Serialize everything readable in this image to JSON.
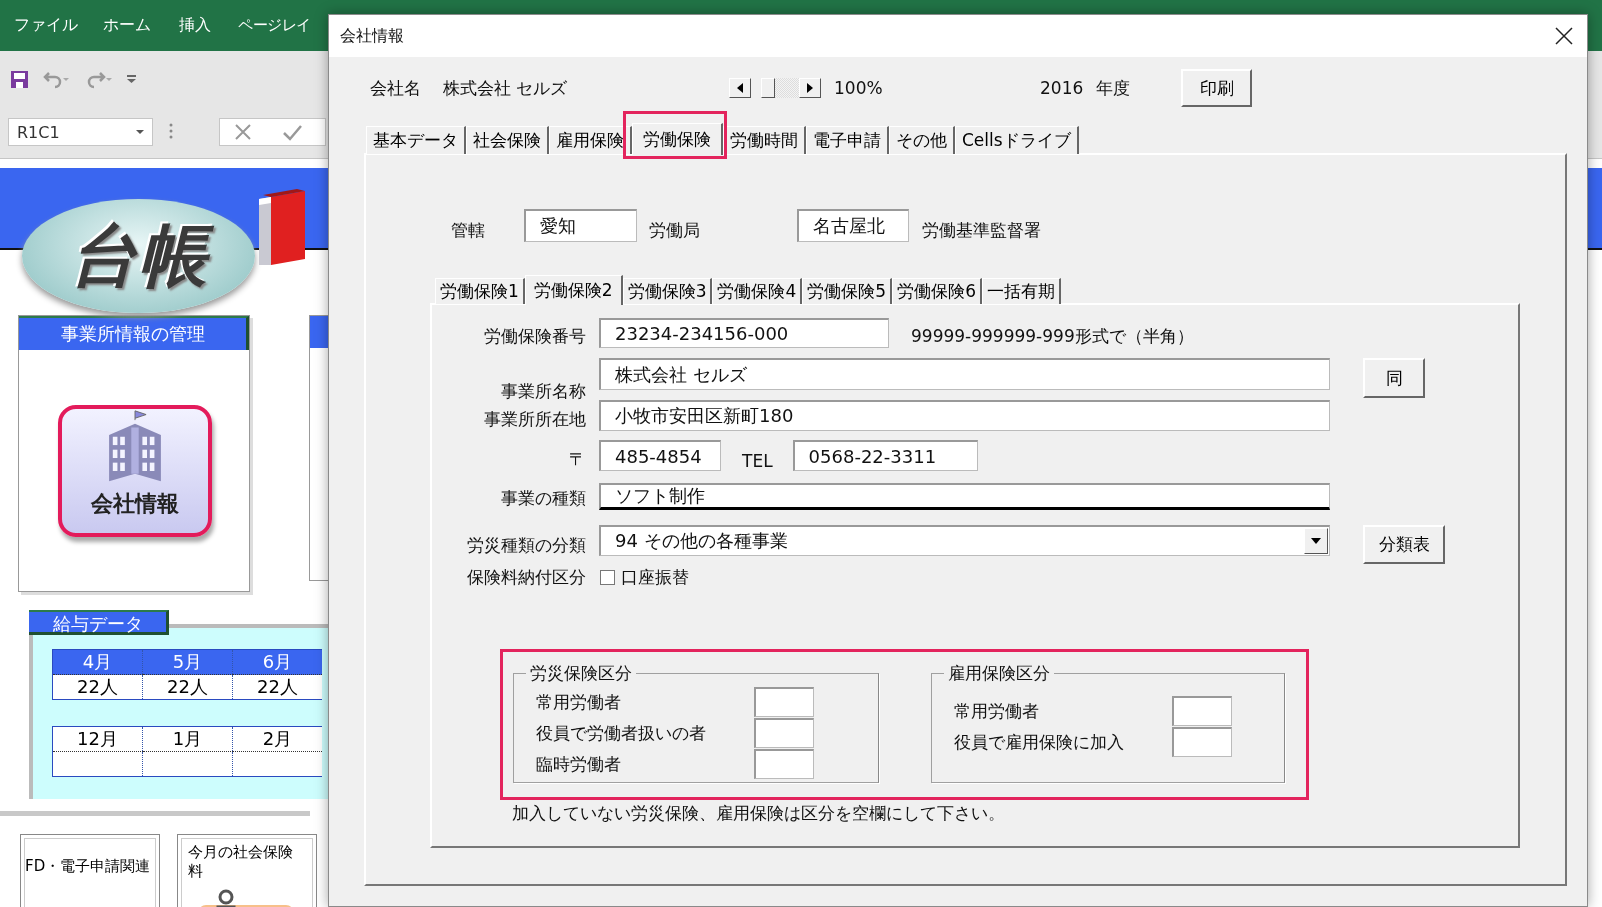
{
  "app": {
    "menu": [
      "ファイル",
      "ホーム",
      "挿入",
      "ページレイ"
    ],
    "name_box": "R1C1"
  },
  "sheet": {
    "logo": "台帳",
    "company_panel": {
      "title": "事業所情報の管理",
      "button": "会社情報"
    },
    "salary": {
      "title": "給与データ",
      "rows": [
        {
          "highlighted": true,
          "cells": [
            {
              "month": "4月",
              "count": "22人"
            },
            {
              "month": "5月",
              "count": "22人"
            },
            {
              "month": "6月",
              "count": "22人"
            }
          ]
        },
        {
          "highlighted": false,
          "cells": [
            {
              "month": "12月"
            },
            {
              "month": "1月"
            },
            {
              "month": "2月"
            }
          ]
        }
      ]
    },
    "links": [
      "FD・電子申請関連",
      "今月の社会保険料"
    ]
  },
  "dialog": {
    "title": "会社情報",
    "company_label": "会社名",
    "company_name": "株式会社 セルズ",
    "zoom": "100%",
    "year": "2016",
    "year_label": "年度",
    "print_button": "印刷",
    "tabs": [
      {
        "label": "基本データ",
        "selected": false
      },
      {
        "label": "社会保険",
        "selected": false
      },
      {
        "label": "雇用保険",
        "selected": false
      },
      {
        "label": "労働保険",
        "selected": true
      },
      {
        "label": "労働時間",
        "selected": false
      },
      {
        "label": "電子申請",
        "selected": false
      },
      {
        "label": "その他",
        "selected": false
      },
      {
        "label": "Cellsドライブ",
        "selected": false
      }
    ],
    "jurisdiction": {
      "label": "管轄",
      "bureau": "愛知",
      "bureau_suffix": "労働局",
      "office": "名古屋北",
      "office_suffix": "労働基準監督署"
    },
    "subtabs": [
      {
        "label": "労働保険1",
        "selected": false
      },
      {
        "label": "労働保険2",
        "selected": true
      },
      {
        "label": "労働保険3",
        "selected": false
      },
      {
        "label": "労働保険4",
        "selected": false
      },
      {
        "label": "労働保険5",
        "selected": false
      },
      {
        "label": "労働保険6",
        "selected": false
      },
      {
        "label": "一括有期",
        "selected": false
      }
    ],
    "form": {
      "insurance_number": {
        "label": "労働保険番号",
        "value": "23234-234156-000",
        "note": "99999-999999-999形式で（半角）"
      },
      "office_name": {
        "label": "事業所名称",
        "value": "株式会社 セルズ",
        "button": "同"
      },
      "address": {
        "label": "事業所所在地",
        "value": "小牧市安田区新町180"
      },
      "postal": {
        "label": "〒",
        "value": "485-4854"
      },
      "tel": {
        "label": "TEL",
        "value": "0568-22-3311"
      },
      "business_type": {
        "label": "事業の種類",
        "value": "ソフト制作"
      },
      "accident_class": {
        "label": "労災種類の分類",
        "value": "94 その他の各種事業",
        "button": "分類表"
      },
      "payment": {
        "label": "保険料納付区分",
        "checkbox": {
          "label": "口座振替",
          "checked": false
        }
      },
      "groups": [
        {
          "title": "労災保険区分",
          "items": [
            "常用労働者",
            "役員で労働者扱いの者",
            "臨時労働者"
          ]
        },
        {
          "title": "雇用保険区分",
          "items": [
            "常用労働者",
            "役員で雇用保険に加入"
          ]
        }
      ],
      "note": "加入していない労災保険、雇用保険は区分を空欄にして下さい。"
    }
  }
}
